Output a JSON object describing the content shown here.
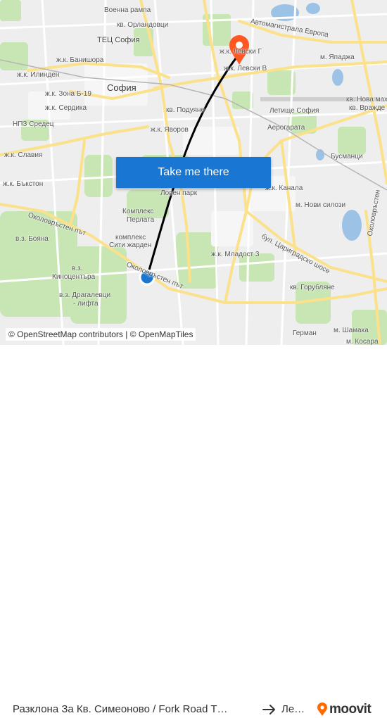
{
  "map": {
    "labels": [
      {
        "id": "voenna-rampa",
        "text": "Военна рампа"
      },
      {
        "id": "orlandovtsi",
        "text": "кв. Орландовци"
      },
      {
        "id": "tets",
        "text": "ТЕЦ София"
      },
      {
        "id": "banishora",
        "text": "ж.к. Банишора"
      },
      {
        "id": "avtomagistrala",
        "text": "Автомагистрала Европа"
      },
      {
        "id": "levski-g",
        "text": "ж.к. Левски Г"
      },
      {
        "id": "levski-v",
        "text": "ж.к. Левски В"
      },
      {
        "id": "yapadzha",
        "text": "м. Япаджа"
      },
      {
        "id": "ilinden",
        "text": "ж.к. Илинден"
      },
      {
        "id": "sofia",
        "text": "София"
      },
      {
        "id": "zona-b19",
        "text": "ж.к. Зона Б-19"
      },
      {
        "id": "nova-mah",
        "text": "кв. Нова мах"
      },
      {
        "id": "vrazhde",
        "text": "кв. Вражде"
      },
      {
        "id": "serdika",
        "text": "ж.к. Сердика"
      },
      {
        "id": "letishte",
        "text": "Летище София"
      },
      {
        "id": "npz",
        "text": "НПЗ Средец"
      },
      {
        "id": "poduyane",
        "text": "кв. Подуяне"
      },
      {
        "id": "aerogara",
        "text": "Аерогарата"
      },
      {
        "id": "yavorov",
        "text": "ж.к. Яворов"
      },
      {
        "id": "slavia",
        "text": "ж.к. Славия"
      },
      {
        "id": "busmantsi",
        "text": "Бусманци"
      },
      {
        "id": "bakston",
        "text": "ж.к. Бъкстон"
      },
      {
        "id": "loven-park",
        "text": "Ловен парк"
      },
      {
        "id": "kanala",
        "text": "ж.к. Канала"
      },
      {
        "id": "novi-silozi",
        "text": "м. Нови силози"
      },
      {
        "id": "okolovrasten-1",
        "text": "Околовръстен път"
      },
      {
        "id": "kompleks-perlata-1",
        "text": "Комплекс"
      },
      {
        "id": "kompleks-perlata-2",
        "text": "Перлата"
      },
      {
        "id": "boyana",
        "text": "в.з. Бояна"
      },
      {
        "id": "siti-1",
        "text": "комплекс"
      },
      {
        "id": "siti-2",
        "text": "Сити жарден"
      },
      {
        "id": "tsarigradsko",
        "text": "бул. Цариградско шосе"
      },
      {
        "id": "mladost3",
        "text": "ж.к. Младост 3"
      },
      {
        "id": "kinotsentara-1",
        "text": "в.з."
      },
      {
        "id": "kinotsentara-2",
        "text": "Киноцентъра"
      },
      {
        "id": "okolovrasten-2",
        "text": "Околовръстен път"
      },
      {
        "id": "dragalevtsi",
        "text": "в.з. Драгалевци"
      },
      {
        "id": "lifta",
        "text": "- лифта"
      },
      {
        "id": "gorublyane",
        "text": "кв. Горубляне"
      },
      {
        "id": "okolovrasten-3",
        "text": "Околовръстен"
      },
      {
        "id": "german",
        "text": "Герман"
      },
      {
        "id": "shamaka",
        "text": "м. Шамака"
      },
      {
        "id": "kosara",
        "text": "м. Косара"
      }
    ],
    "cta_label": "Take me there",
    "attribution_osm_icon": "©",
    "attribution_maptiles": "© OpenStreetMap contributors | © OpenMapTiles",
    "origin_marker_color": "#1976D2",
    "destination_marker_color": "#FF5722",
    "route_color": "#000000"
  },
  "footer": {
    "route_text": "Разклона За Кв. Симеоново / Fork Road T…",
    "arrow_icon": "right-arrow-icon",
    "destination_text": "Ле…",
    "logo_text": "moovit",
    "logo_color": "#FF6A00"
  }
}
